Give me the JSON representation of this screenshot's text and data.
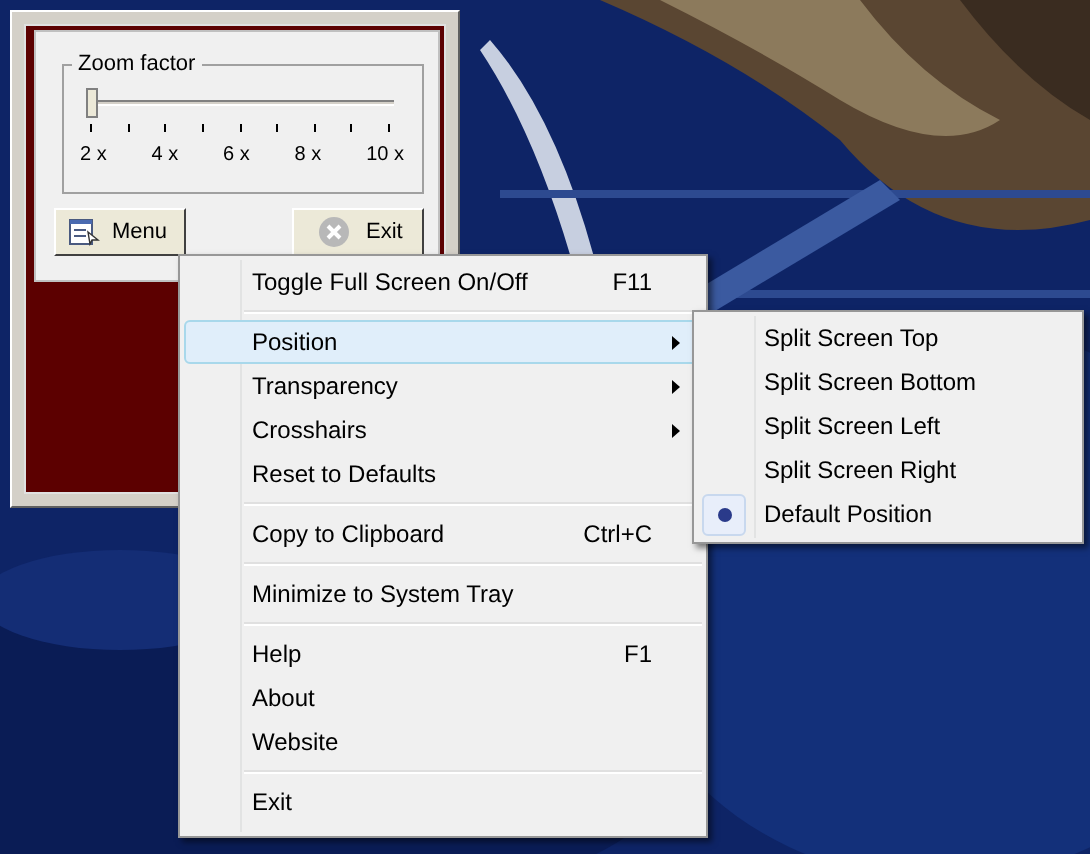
{
  "window": {
    "zoom_group": {
      "title": "Zoom factor",
      "slider": {
        "level": 0
      },
      "tick_labels": [
        "2 x",
        "4 x",
        "6 x",
        "8 x",
        "10 x"
      ]
    },
    "buttons": [
      {
        "kind": "menu",
        "label": "Menu"
      },
      {
        "kind": "exit",
        "label": "Exit"
      }
    ]
  },
  "menu": {
    "items": [
      {
        "kind": "item",
        "label": "Toggle Full Screen On/Off",
        "shortcut": "F11",
        "has_submenu": false,
        "selected": false
      },
      {
        "kind": "separator"
      },
      {
        "kind": "item",
        "label": "Position",
        "has_submenu": true,
        "selected": true
      },
      {
        "kind": "item",
        "label": "Transparency",
        "has_submenu": true,
        "selected": false
      },
      {
        "kind": "item",
        "label": "Crosshairs",
        "has_submenu": true,
        "selected": false
      },
      {
        "kind": "item",
        "label": "Reset to Defaults",
        "has_submenu": false,
        "selected": false
      },
      {
        "kind": "separator"
      },
      {
        "kind": "item",
        "label": "Copy to Clipboard",
        "shortcut": "Ctrl+C",
        "has_submenu": false,
        "selected": false
      },
      {
        "kind": "separator"
      },
      {
        "kind": "item",
        "label": "Minimize to System Tray",
        "has_submenu": false,
        "selected": false
      },
      {
        "kind": "separator"
      },
      {
        "kind": "item",
        "label": "Help",
        "shortcut": "F1",
        "has_submenu": false,
        "selected": false
      },
      {
        "kind": "item",
        "label": "About",
        "has_submenu": false,
        "selected": false
      },
      {
        "kind": "item",
        "label": "Website",
        "has_submenu": false,
        "selected": false
      },
      {
        "kind": "separator"
      },
      {
        "kind": "item",
        "label": "Exit",
        "has_submenu": false,
        "selected": false
      }
    ]
  },
  "submenu": {
    "items": [
      {
        "label": "Split Screen Top",
        "checked": false
      },
      {
        "label": "Split Screen Bottom",
        "checked": false
      },
      {
        "label": "Split Screen Left",
        "checked": false
      },
      {
        "label": "Split Screen Right",
        "checked": false
      },
      {
        "label": "Default Position",
        "checked": true
      }
    ]
  }
}
